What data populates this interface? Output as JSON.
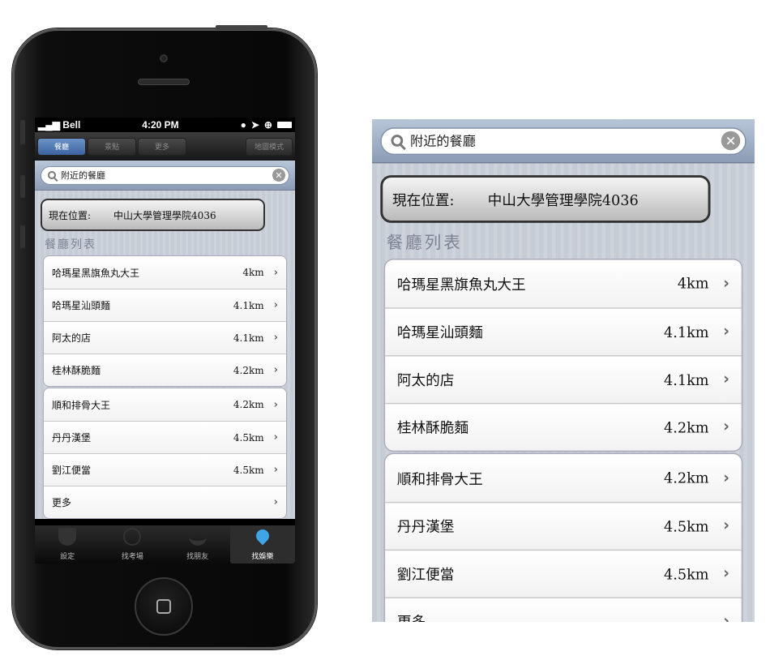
{
  "status": {
    "carrier": "Bell",
    "time": "4:20 PM"
  },
  "segments": [
    {
      "label": "餐廳",
      "active": true
    },
    {
      "label": "景點"
    },
    {
      "label": "更多"
    }
  ],
  "map_mode": "地圖模式",
  "search": {
    "value": "附近的餐廳"
  },
  "location": {
    "label": "現在位置:",
    "value": "中山大學管理學院4036"
  },
  "section_title": "餐廳列表",
  "groups": [
    [
      {
        "name": "哈瑪星黑旗魚丸大王",
        "distance": "4km"
      },
      {
        "name": "哈瑪星汕頭麵",
        "distance": "4.1km"
      },
      {
        "name": "阿太的店",
        "distance": "4.1km"
      },
      {
        "name": "桂林酥脆麵",
        "distance": "4.2km"
      }
    ],
    [
      {
        "name": "順和排骨大王",
        "distance": "4.2km"
      },
      {
        "name": "丹丹漢堡",
        "distance": "4.5km"
      },
      {
        "name": "劉江便當",
        "distance": "4.5km"
      },
      {
        "name": "更多",
        "distance": ""
      }
    ]
  ],
  "tabs": [
    {
      "label": "設定",
      "icon": "shield-icon"
    },
    {
      "label": "找考場",
      "icon": "crosshair-icon"
    },
    {
      "label": "找朋友",
      "icon": "joystick-icon"
    },
    {
      "label": "找娛樂",
      "icon": "map-pin-icon",
      "active": true
    }
  ],
  "colors": {
    "accent": "#3c63a0",
    "pin": "#3fa5e6"
  }
}
